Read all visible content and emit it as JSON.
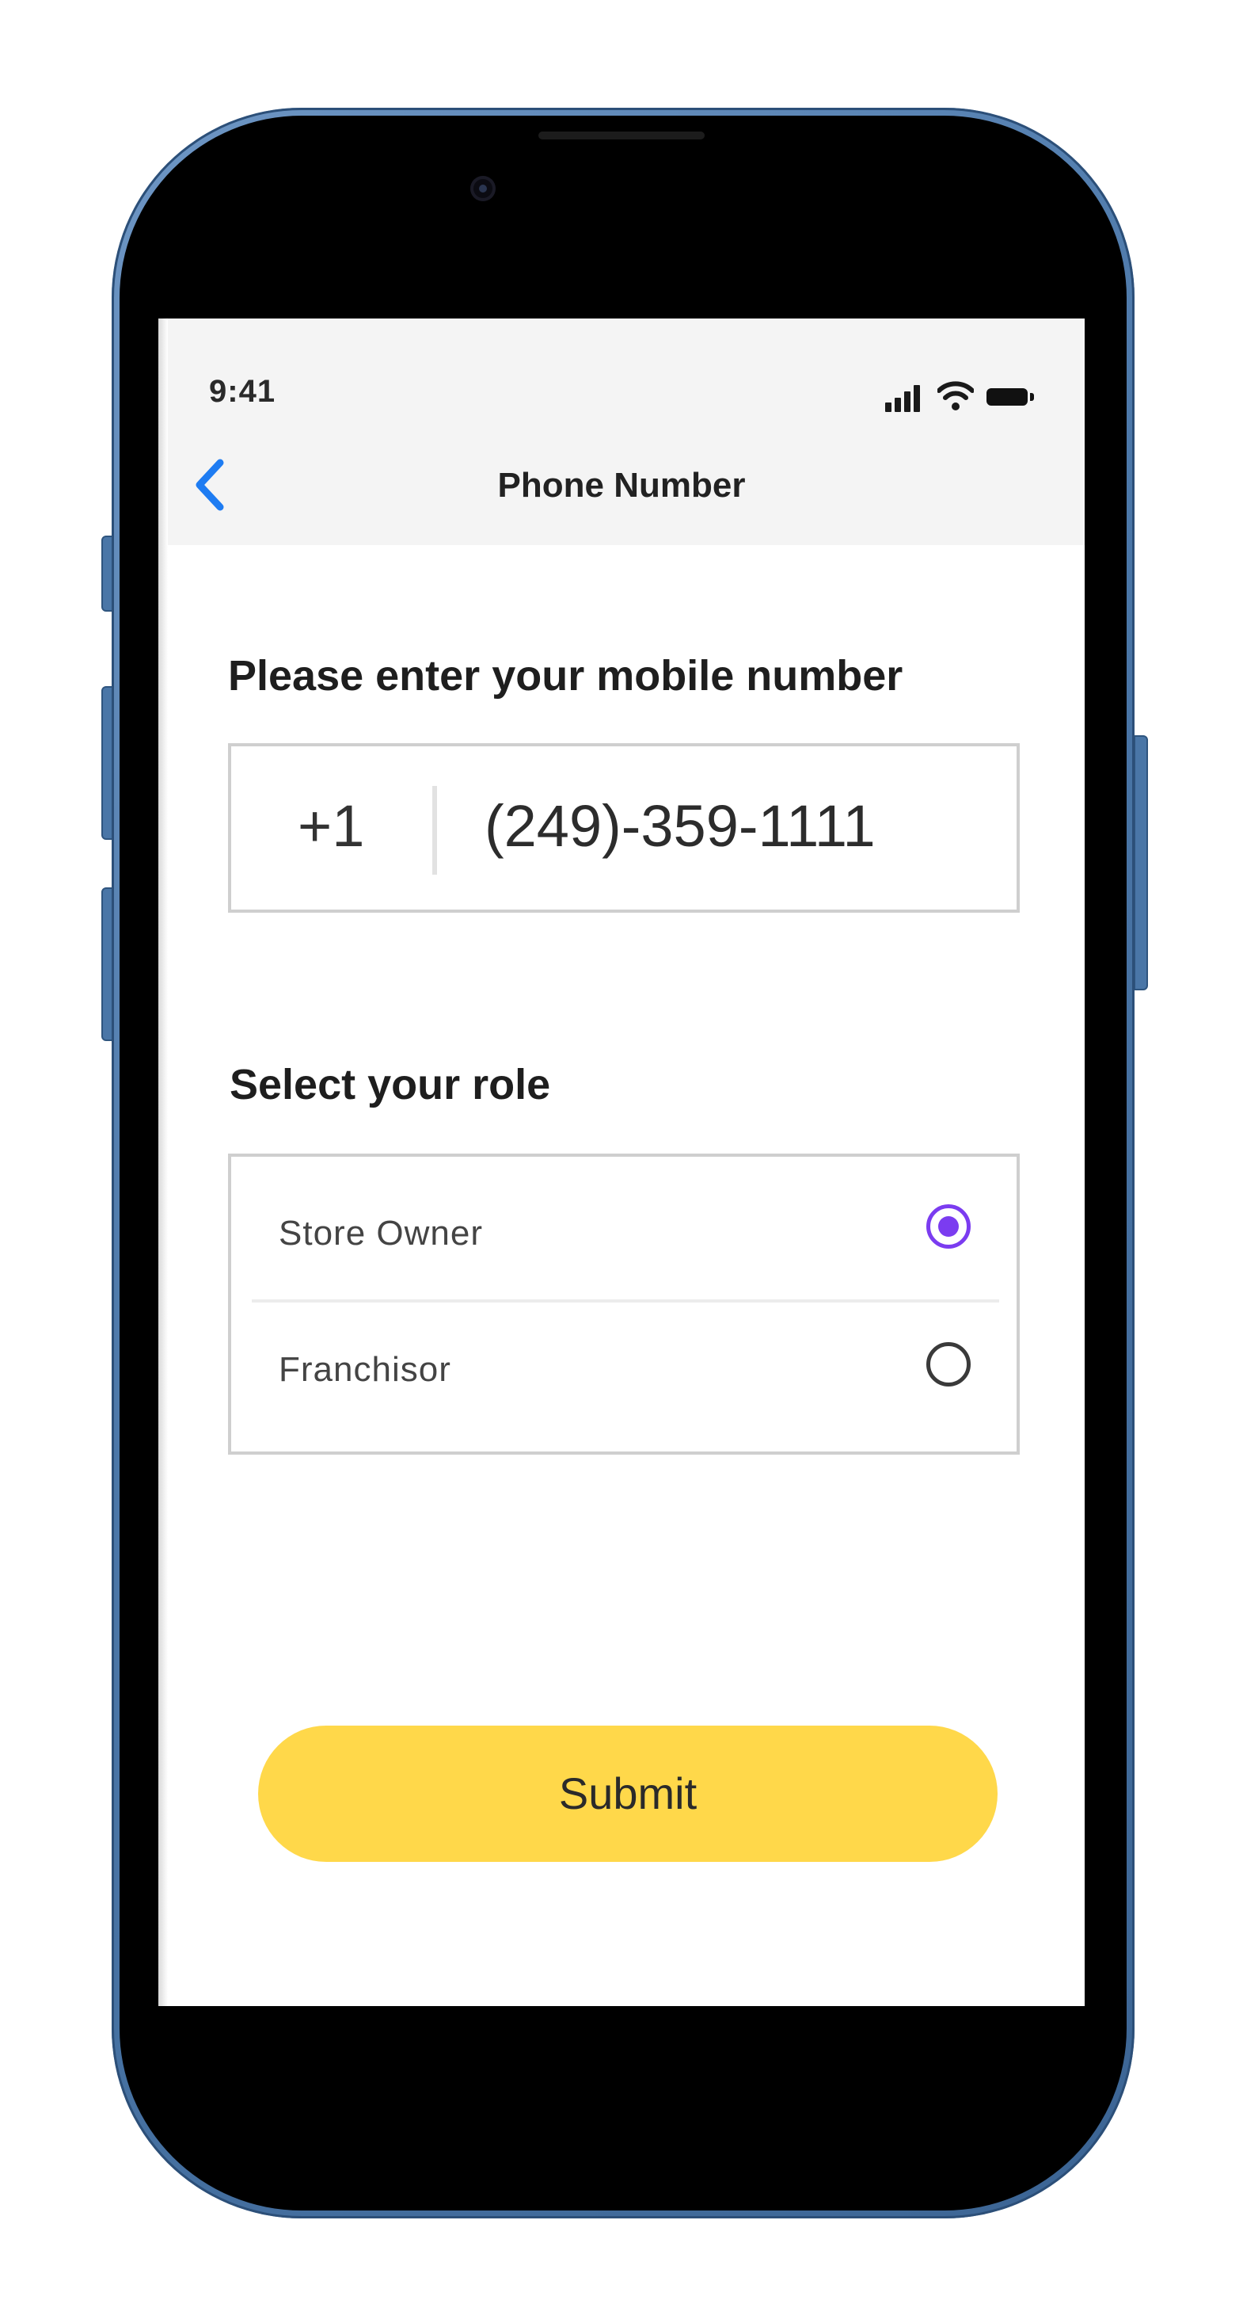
{
  "status_bar": {
    "time": "9:41",
    "icons": [
      "cellular-signal-icon",
      "wifi-icon",
      "battery-icon"
    ]
  },
  "nav": {
    "back_icon": "chevron-left-icon",
    "title": "Phone Number"
  },
  "phone_section": {
    "title": "Please enter your mobile number",
    "country_code": "+1",
    "phone_number": "(249)-359-1111"
  },
  "role_section": {
    "title": "Select your role",
    "options": [
      {
        "label": "Store Owner",
        "selected": true
      },
      {
        "label": "Franchisor",
        "selected": false
      }
    ]
  },
  "submit": {
    "label": "Submit"
  },
  "colors": {
    "accent_radio": "#7b3cf0",
    "submit_background": "#ffd84a",
    "back_chevron": "#1e7cf2",
    "top_bar_background": "#f4f4f4",
    "phone_frame": "#4b77a8"
  }
}
